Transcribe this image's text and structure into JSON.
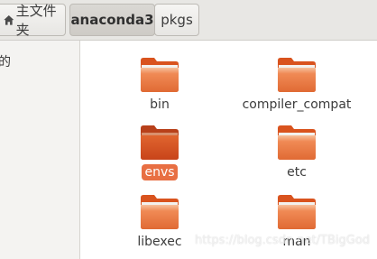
{
  "breadcrumbs": [
    {
      "label": "主文件夹",
      "icon": "home-icon"
    },
    {
      "label": "anaconda3"
    },
    {
      "label": "pkgs"
    }
  ],
  "sidebar": {
    "partial_text": "的"
  },
  "files": [
    {
      "name": "bin",
      "type": "folder",
      "selected": false
    },
    {
      "name": "compiler_compat",
      "type": "folder",
      "selected": false
    },
    {
      "name": "envs",
      "type": "folder",
      "selected": true
    },
    {
      "name": "etc",
      "type": "folder",
      "selected": false
    },
    {
      "name": "libexec",
      "type": "folder",
      "selected": false
    },
    {
      "name": "man",
      "type": "folder",
      "selected": false
    }
  ],
  "watermark": "https://blog.csdn.net/TBigGod",
  "colors": {
    "folder_light": "#f08a55",
    "folder_dark": "#d9531e",
    "selection": "#e86f43"
  }
}
